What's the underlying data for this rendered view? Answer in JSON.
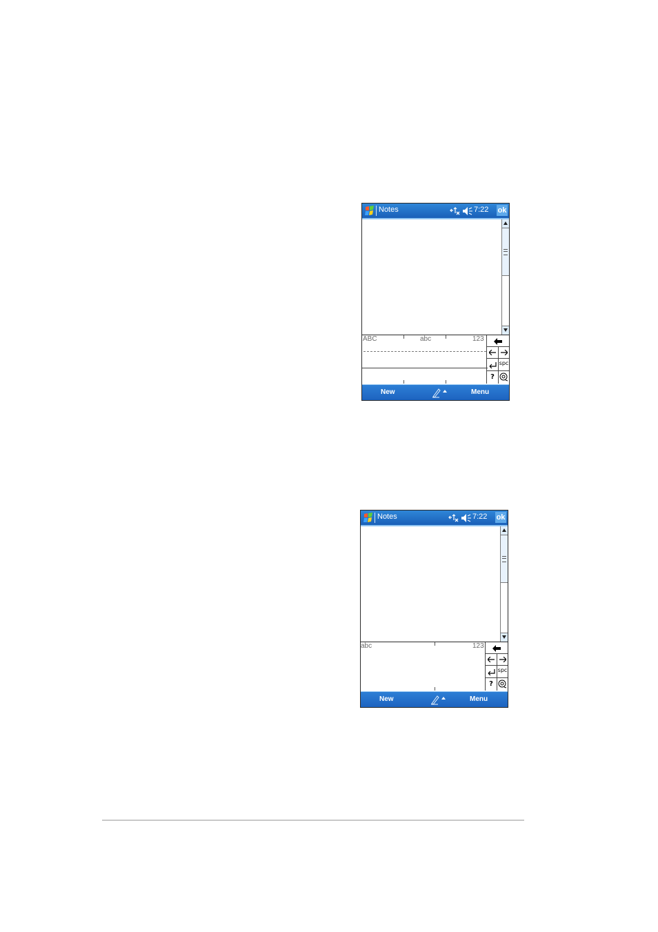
{
  "screens": [
    {
      "title": "Notes",
      "time": "7:22",
      "ok_label": "ok",
      "input_panel": {
        "labels": [
          "ABC",
          "abc",
          "123"
        ],
        "mode": "letter-recognizer-three-zone",
        "keys": [
          "backspace-icon",
          "left-arrow-icon",
          "right-arrow-icon",
          "enter-icon",
          "spc",
          "?",
          "at-icon"
        ]
      },
      "menubar": {
        "left": "New",
        "right": "Menu",
        "center_icon": "pen-icon"
      },
      "icons": [
        "start-icon",
        "connectivity-icon",
        "speaker-icon"
      ]
    },
    {
      "title": "Notes",
      "time": "7:22",
      "ok_label": "ok",
      "input_panel": {
        "labels": [
          "abc",
          "123"
        ],
        "mode": "letter-recognizer-two-zone",
        "keys": [
          "backspace-icon",
          "left-arrow-icon",
          "right-arrow-icon",
          "enter-icon",
          "spc",
          "?",
          "at-icon"
        ]
      },
      "menubar": {
        "left": "New",
        "right": "Menu",
        "center_icon": "pen-icon"
      },
      "icons": [
        "start-icon",
        "connectivity-icon",
        "speaker-icon"
      ]
    }
  ],
  "colors": {
    "titlebar": "#1f6fc7",
    "menubar": "#1d63c0",
    "ok_button": "#5ea9ea"
  }
}
